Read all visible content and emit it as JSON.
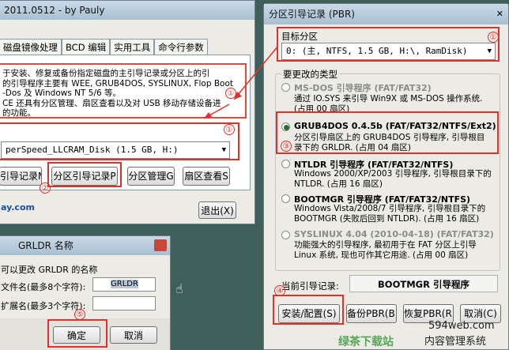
{
  "left_window": {
    "title": "2011.0512 - by Pauly",
    "tabs": [
      "磁盘镜像处理",
      "BCD 编辑",
      "实用工具",
      "命令行参数"
    ],
    "description": "于安装、修复或备份指定磁盘的主引导记录或分区上的引\n的引导程序主要有 WEE, GRUB4DOS, SYSLINUX, Flop Boot\n-Dos 及 Windows NT 5/6 等。\nCE 还具有分区管理、扇区查看以及对 USB 移动存储设备进\n的功能。",
    "disk_combo": "perSpeed_LLCRAM_Disk (1.5 GB, H:)",
    "btn_mbr": "引导记录M",
    "btn_pbr": "分区引导记录P",
    "btn_partition": "分区管理G",
    "btn_sector": "扇区查看S",
    "link": "ay.com",
    "btn_exit": "退出(X)"
  },
  "dialog": {
    "title": "GRLDR 名称",
    "prompt": "可以更改 GRLDR 的名称",
    "filename_label": "文件名(最多8个字符):",
    "filename_value": "GRLDR",
    "ext_label": "扩展名(最多3个字符):",
    "ext_value": "",
    "ok": "确定",
    "cancel": "取消"
  },
  "pbr_window": {
    "title": "分区引导记录 (PBR)",
    "target_label": "目标分区",
    "target_value": "0:  (主,   NTFS,     1.5 GB, H:\\, RamDisk)",
    "type_label": "要更改的类型",
    "options": [
      {
        "title": "MS-DOS 引导程序 (FAT/FAT32)",
        "desc": "通过 IO.SYS 来引导 Win9X 或 MS-DOS 操作系统.\n(占用 00 扇区)",
        "selected": false,
        "enabled": false
      },
      {
        "title": "GRUB4DOS 0.4.5b (FAT/FAT32/NTFS/Ext2)",
        "desc": "分区引导扇区上的 GRUB4DOS 引导程序, 引导根目\n录下的 GRLDR. (占用 04 扇区)",
        "selected": true,
        "enabled": true
      },
      {
        "title": "NTLDR 引导程序 (FAT/FAT32/NTFS)",
        "desc": "Windows 2000/XP/2003 引导程序, 引导根目录下的\nNTLDR. (占用 16 扇区)",
        "selected": false,
        "enabled": true
      },
      {
        "title": "BOOTMGR 引导程序 (FAT/FAT32/NTFS)",
        "desc": "Windows Vista/2008/7 引导程序, 引导根目录下的\nBOOTMGR (失败后回到 NTLDR). (占用 16 扇区)",
        "selected": false,
        "enabled": true
      },
      {
        "title": "SYSLINUX 4.04 (2010-04-18) (FAT/FAT32)",
        "desc": "功能强大的引导程序, 最初用于在 FAT 分区上引导\nLinux 系统, 现也可作其它用途. (占用 00 扇区)",
        "selected": false,
        "enabled": true
      }
    ],
    "current_label": "当前引导记录:",
    "current_value": "BOOTMGR 引导程序",
    "btn_install": "安装/配置(S)",
    "btn_backup": "备份PBR(B)",
    "btn_restore": "恢复PBR(R)",
    "btn_cancel": "取消(C)"
  },
  "markers": [
    "①",
    "①",
    "①",
    "②",
    "③",
    "④",
    "⑤"
  ],
  "watermark": {
    "line1": "594web.com",
    "line2": "内容管理系统",
    "green": "绿茶下载站"
  }
}
